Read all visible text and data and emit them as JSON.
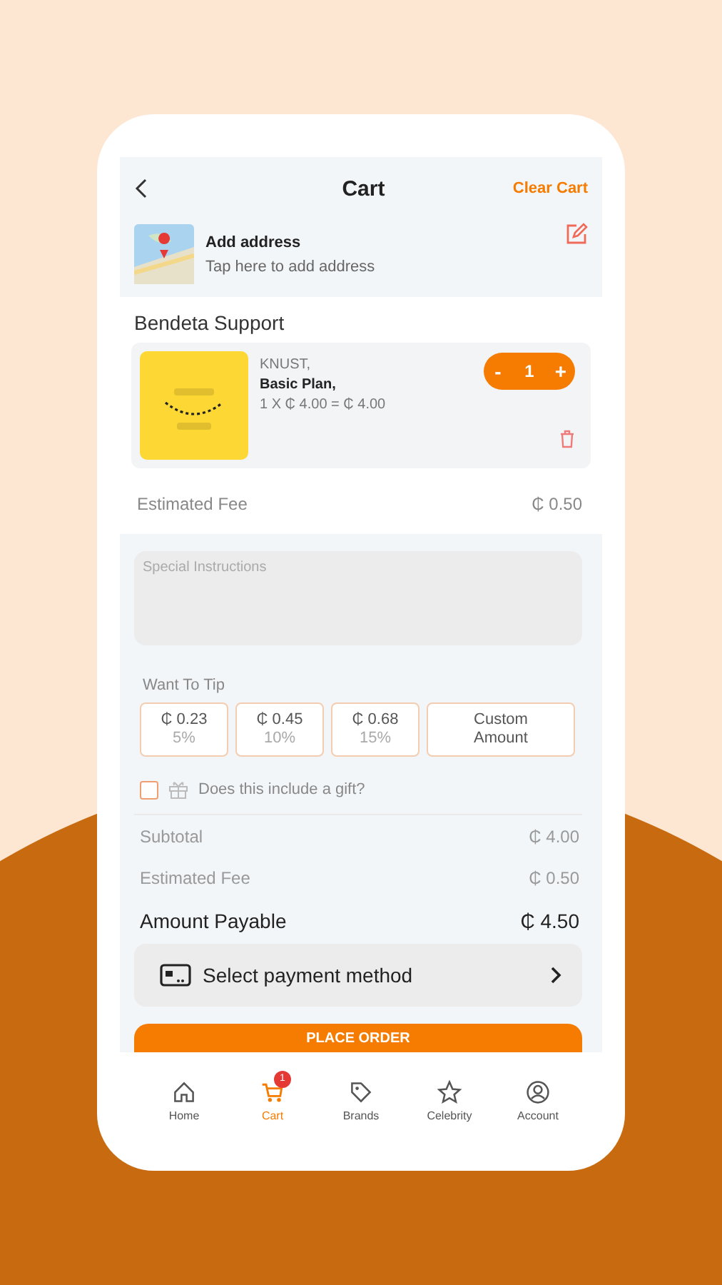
{
  "header": {
    "title": "Cart",
    "action": "Clear Cart"
  },
  "address": {
    "title": "Add address",
    "subtitle": "Tap here to add address"
  },
  "store": "Bendeta Support",
  "items": [
    {
      "location": "KNUST,",
      "name": "Basic Plan,",
      "price_line": "1 X ₵ 4.00 = ₵ 4.00",
      "quantity": "1",
      "decrement": "-",
      "increment": "+"
    }
  ],
  "estimated_fee": {
    "label": "Estimated Fee",
    "value": "₵ 0.50"
  },
  "instructions": {
    "placeholder": "Special Instructions"
  },
  "tip": {
    "label": "Want To Tip",
    "options": [
      {
        "kind": "preset",
        "amount": "₵ 0.23",
        "percent": "5%",
        "selected": false
      },
      {
        "kind": "preset",
        "amount": "₵ 0.45",
        "percent": "10%",
        "selected": false
      },
      {
        "kind": "preset",
        "amount": "₵ 0.68",
        "percent": "15%",
        "selected": false
      },
      {
        "kind": "custom",
        "amount": "Custom Amount",
        "selected": false
      }
    ]
  },
  "gift": {
    "label": "Does this include a gift?",
    "checked": false
  },
  "summary": [
    {
      "kind": "line",
      "label": "Subtotal",
      "value": "₵ 4.00"
    },
    {
      "kind": "line",
      "label": "Estimated Fee",
      "value": "₵ 0.50"
    },
    {
      "kind": "total",
      "label": "Amount Payable",
      "value": "₵ 4.50"
    }
  ],
  "payment": {
    "label": "Select payment method"
  },
  "place_order": "PLACE ORDER",
  "nav": [
    {
      "label": "Home",
      "selected": false
    },
    {
      "label": "Cart",
      "selected": true,
      "badge": "1"
    },
    {
      "label": "Brands",
      "selected": false
    },
    {
      "label": "Celebrity",
      "selected": false
    },
    {
      "label": "Account",
      "selected": false
    }
  ]
}
